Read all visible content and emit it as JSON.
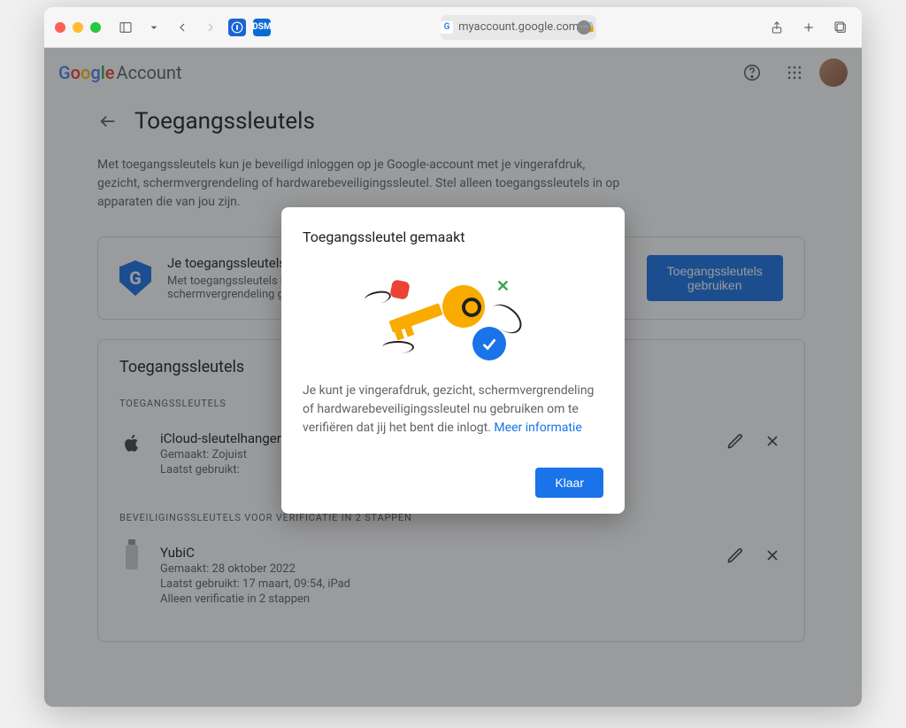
{
  "browser": {
    "url": "myaccount.google.com"
  },
  "header": {
    "brand_google": "Google",
    "brand_account": " Account"
  },
  "page": {
    "title": "Toegangssleutels",
    "intro": "Met toegangssleutels kun je beveiligd inloggen op je Google-account met je vingerafdruk, gezicht, schermvergrendeling of hardwarebeveiligingssleutel. Stel alleen toegangssleutels in op apparaten die van jou zijn."
  },
  "promo": {
    "title": "Je toegangssleutels",
    "subtitle": "Met toegangssleutels kun je een vorm van biometrische beveiliging of schermvergrendeling gebruiken om te verifiëren dat jij het bent.",
    "button": "Toegangssleutels gebruiken"
  },
  "list": {
    "heading": "Toegangssleutels",
    "subhead1": "TOEGANGSSLEUTELS",
    "subhead2": "BEVEILIGINGSSLEUTELS VOOR VERIFICATIE IN 2 STAPPEN",
    "keys": [
      {
        "name": "iCloud-sleutelhanger",
        "created": "Gemaakt: Zojuist",
        "last": "Laatst gebruikt:"
      }
    ],
    "sec_keys": [
      {
        "name": "YubiC",
        "created": "Gemaakt: 28 oktober 2022",
        "last": "Laatst gebruikt: 17 maart, 09:54, iPad",
        "note": "Alleen verificatie in 2 stappen"
      }
    ]
  },
  "modal": {
    "title": "Toegangssleutel gemaakt",
    "body": "Je kunt je vingerafdruk, gezicht, schermvergrendeling of hardwarebeveiligingssleutel nu gebruiken om te verifiëren dat jij het bent die inlogt. ",
    "link": "Meer informatie",
    "confirm": "Klaar"
  }
}
